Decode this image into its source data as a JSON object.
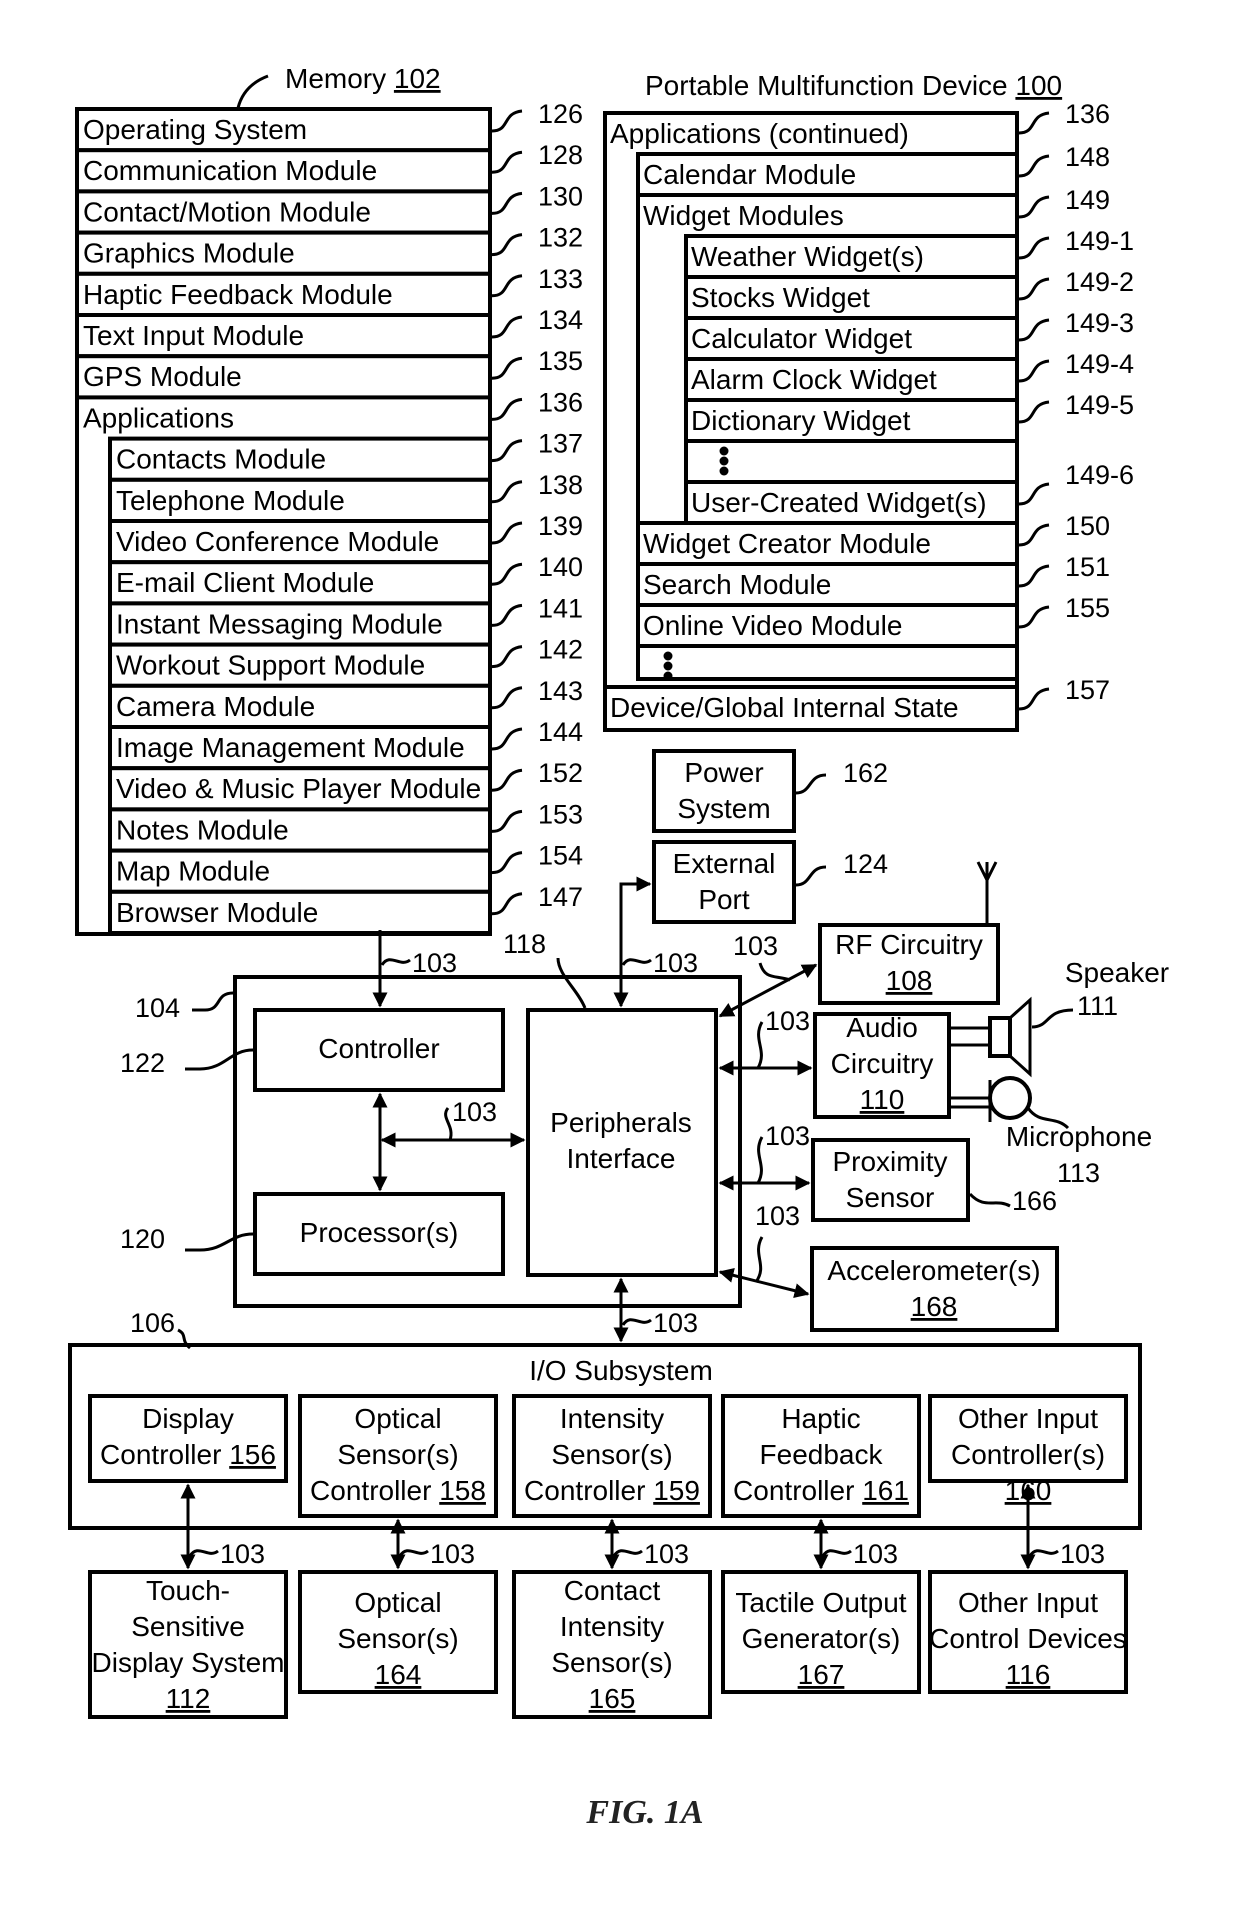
{
  "figure_label": "FIG. 1A",
  "memory": {
    "title": "Memory",
    "ref": "102",
    "rows": [
      {
        "label": "Operating System",
        "ref": "126"
      },
      {
        "label": "Communication Module",
        "ref": "128"
      },
      {
        "label": "Contact/Motion Module",
        "ref": "130"
      },
      {
        "label": "Graphics Module",
        "ref": "132"
      },
      {
        "label": "Haptic Feedback Module",
        "ref": "133"
      },
      {
        "label": "Text Input Module",
        "ref": "134"
      },
      {
        "label": "GPS Module",
        "ref": "135"
      },
      {
        "label": "Applications",
        "ref": "136"
      }
    ],
    "applications": [
      {
        "label": "Contacts Module",
        "ref": "137"
      },
      {
        "label": "Telephone Module",
        "ref": "138"
      },
      {
        "label": "Video Conference Module",
        "ref": "139"
      },
      {
        "label": "E-mail Client Module",
        "ref": "140"
      },
      {
        "label": "Instant Messaging Module",
        "ref": "141"
      },
      {
        "label": "Workout Support Module",
        "ref": "142"
      },
      {
        "label": "Camera Module",
        "ref": "143"
      },
      {
        "label": "Image Management Module",
        "ref": "144"
      },
      {
        "label": "Video & Music Player Module",
        "ref": "152"
      },
      {
        "label": "Notes Module",
        "ref": "153"
      },
      {
        "label": "Map Module",
        "ref": "154"
      },
      {
        "label": "Browser Module",
        "ref": "147"
      }
    ]
  },
  "device": {
    "title": "Portable Multifunction Device",
    "ref": "100",
    "apps_continued": {
      "label": "Applications (continued)",
      "ref": "136"
    },
    "calendar": {
      "label": "Calendar Module",
      "ref": "148"
    },
    "widget_modules": {
      "label": "Widget Modules",
      "ref": "149"
    },
    "widgets": [
      {
        "label": "Weather Widget(s)",
        "ref": "149-1"
      },
      {
        "label": "Stocks Widget",
        "ref": "149-2"
      },
      {
        "label": "Calculator Widget",
        "ref": "149-3"
      },
      {
        "label": "Alarm Clock Widget",
        "ref": "149-4"
      },
      {
        "label": "Dictionary Widget",
        "ref": "149-5"
      },
      {
        "label": "",
        "ref": ""
      },
      {
        "label": "User-Created Widget(s)",
        "ref": "149-6"
      }
    ],
    "more_modules": [
      {
        "label": "Widget Creator Module",
        "ref": "150"
      },
      {
        "label": "Search Module",
        "ref": "151"
      },
      {
        "label": "Online Video Module",
        "ref": "155"
      }
    ],
    "state": {
      "label": "Device/Global Internal State",
      "ref": "157"
    }
  },
  "power": {
    "line1": "Power",
    "line2": "System",
    "ref": "162"
  },
  "external_port": {
    "line1": "External",
    "line2": "Port",
    "ref": "124"
  },
  "chip": {
    "ref": "104",
    "controller": {
      "label": "Controller",
      "ref": "122"
    },
    "processor": {
      "label": "Processor(s)",
      "ref": "120"
    },
    "peripherals": {
      "line1": "Peripherals",
      "line2": "Interface",
      "ref": "118"
    }
  },
  "bus_ref": "103",
  "rf": {
    "line1": "RF Circuitry",
    "num": "108"
  },
  "audio": {
    "line1": "Audio",
    "line2": "Circuitry",
    "num": "110"
  },
  "speaker": {
    "label": "Speaker",
    "ref": "111"
  },
  "microphone": {
    "label": "Microphone",
    "ref": "113"
  },
  "proximity": {
    "line1": "Proximity",
    "line2": "Sensor",
    "ref": "166"
  },
  "accelerometer": {
    "line1": "Accelerometer(s)",
    "num": "168"
  },
  "io": {
    "title": "I/O Subsystem",
    "ref": "106",
    "controllers": [
      {
        "lines": [
          "Display",
          "Controller"
        ],
        "num": "156"
      },
      {
        "lines": [
          "Optical",
          "Sensor(s)",
          "Controller"
        ],
        "num": "158"
      },
      {
        "lines": [
          "Intensity",
          "Sensor(s)",
          "Controller"
        ],
        "num": "159"
      },
      {
        "lines": [
          "Haptic",
          "Feedback",
          "Controller"
        ],
        "num": "161"
      },
      {
        "lines": [
          "Other Input",
          "Controller(s)"
        ],
        "num": "160"
      }
    ],
    "devices": [
      {
        "lines": [
          "Touch-",
          "Sensitive",
          "Display System"
        ],
        "num": "112"
      },
      {
        "lines": [
          "Optical",
          "Sensor(s)"
        ],
        "num": "164"
      },
      {
        "lines": [
          "Contact",
          "Intensity",
          "Sensor(s)"
        ],
        "num": "165"
      },
      {
        "lines": [
          "Tactile Output",
          "Generator(s)"
        ],
        "num": "167"
      },
      {
        "lines": [
          "Other Input",
          "Control Devices"
        ],
        "num": "116"
      }
    ]
  }
}
